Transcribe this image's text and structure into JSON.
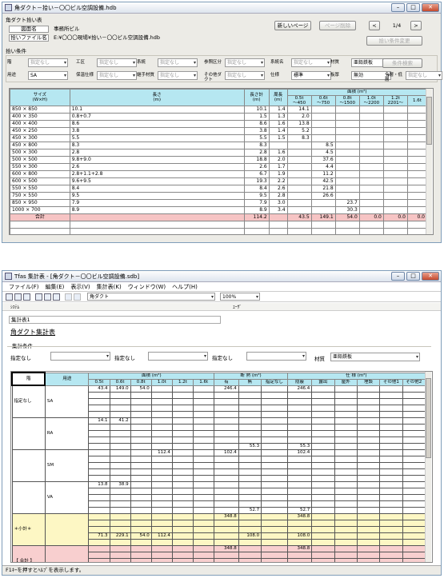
{
  "w1": {
    "title": "角ダクト－拾い－〇〇ビル空調設備.hdb",
    "section": "角ダクト拾い表",
    "drawing_label": "図面名",
    "drawing_value": "事務所ビル",
    "file_label": "拾いファイル名",
    "file_value": "E:¥〇〇〇現場¥拾い－〇〇ビル空調設備.hdb",
    "btn_new_page": "新しいページ",
    "btn_delete_page": "ページ削除",
    "btn_prev": "<",
    "page": "1/4",
    "btn_next": ">",
    "btn_change_cond": "拾い条件変更",
    "cond_label": "拾い条件",
    "btn_cond_search": "条件検索",
    "filters": [
      {
        "label": "階",
        "value": "指定なし"
      },
      {
        "label": "工区",
        "value": "指定なし"
      },
      {
        "label": "系統",
        "value": "指定なし"
      },
      {
        "label": "参照区分",
        "value": "指定なし"
      },
      {
        "label": "系統名",
        "value": "指定なし"
      },
      {
        "label": "材質",
        "value": "亜鉛鉄板",
        "on": true
      },
      {
        "label": "用途",
        "value": "SA",
        "on": true
      },
      {
        "label": "保温仕様",
        "value": "指定なし"
      },
      {
        "label": "継手材質",
        "value": "指定なし"
      },
      {
        "label": "その他ダクト",
        "value": "指定なし"
      },
      {
        "label": "仕様",
        "value": "標準",
        "on": true
      },
      {
        "label": "板厚",
        "value": "無効",
        "on": true
      },
      {
        "label": "全層・低層",
        "value": "指定なし"
      }
    ],
    "head": {
      "size": "サイズ\n(W×H)",
      "len": "長さ\n(m)",
      "total_len": "長さ計\n(m)",
      "peri": "周長\n(m)",
      "area": "面積 (m²)",
      "bands": [
        "0.5t\n～450",
        "0.6t\n～750",
        "0.8t\n～1500",
        "1.0t\n～2200",
        "1.2t\n2201～",
        "1.6t"
      ]
    },
    "rows": [
      [
        "850 × 850",
        "10.1",
        "10.1",
        "1.4",
        "14.1",
        "",
        "",
        "",
        "",
        ""
      ],
      [
        "400 × 350",
        "0.8+0.7",
        "1.5",
        "1.3",
        "2.0",
        "",
        "",
        "",
        "",
        ""
      ],
      [
        "400 × 400",
        "8.6",
        "8.6",
        "1.6",
        "13.8",
        "",
        "",
        "",
        "",
        ""
      ],
      [
        "450 × 250",
        "3.8",
        "3.8",
        "1.4",
        "5.2",
        "",
        "",
        "",
        "",
        ""
      ],
      [
        "450 × 300",
        "5.5",
        "5.5",
        "1.5",
        "8.3",
        "",
        "",
        "",
        "",
        ""
      ],
      [
        "450 × 800",
        "8.3",
        "8.3",
        "",
        "",
        "8.5",
        "",
        "",
        "",
        ""
      ],
      [
        "500 × 300",
        "2.8",
        "2.8",
        "1.6",
        "",
        "4.5",
        "",
        "",
        "",
        ""
      ],
      [
        "500 × 500",
        "9.8+9.0",
        "18.8",
        "2.0",
        "",
        "37.6",
        "",
        "",
        "",
        ""
      ],
      [
        "550 × 300",
        "2.6",
        "2.6",
        "1.7",
        "",
        "4.4",
        "",
        "",
        "",
        ""
      ],
      [
        "600 × 800",
        "2.8+1.1+2.8",
        "6.7",
        "1.9",
        "",
        "11.2",
        "",
        "",
        "",
        ""
      ],
      [
        "600 × 500",
        "9.6+9.5",
        "19.3",
        "2.2",
        "",
        "42.5",
        "",
        "",
        "",
        ""
      ],
      [
        "550 × 550",
        "8.4",
        "8.4",
        "2.6",
        "",
        "21.8",
        "",
        "",
        "",
        ""
      ],
      [
        "750 × 550",
        "9.5",
        "9.5",
        "2.8",
        "",
        "26.6",
        "",
        "",
        "",
        ""
      ],
      [
        "850 × 950",
        "7.9",
        "7.9",
        "3.0",
        "",
        "",
        "23.7",
        "",
        "",
        ""
      ],
      [
        "1000 × 700",
        "8.9",
        "8.9",
        "3.4",
        "",
        "",
        "30.3",
        "",
        "",
        ""
      ]
    ],
    "total": [
      "合計",
      "",
      "114.2",
      "",
      "43.5",
      "149.1",
      "54.0",
      "0.0",
      "0.0",
      "0.0"
    ]
  },
  "w2": {
    "title": "Tfas 集計表 - [角ダクト－〇〇ビル空調設備.sdb]",
    "menu": [
      "ファイル(F)",
      "編集(E)",
      "表示(V)",
      "集計表(K)",
      "ウィンドウ(W)",
      "ヘルプ(H)"
    ],
    "combo_type": "角ダクト",
    "zoom": "100%",
    "sys_label": "ｼｽﾃﾑ",
    "user_label": "ﾕｰｻﾞ",
    "sheet_name": "集計表1",
    "heading": "角ダクト集計表",
    "cond_label": "集計条件",
    "conds": [
      "指定なし",
      "指定なし",
      "指定なし"
    ],
    "material_label": "材質",
    "material_value": "亜鉛鉄板",
    "head": {
      "floor": "階",
      "use": "用途",
      "area": "面積 (m²)",
      "thick": [
        "0.5t",
        "0.6t",
        "0.8t",
        "1.0t",
        "1.2t",
        "1.6t"
      ],
      "insul": "断 熱 (m²)",
      "insul_cols": [
        "有",
        "無",
        "指定なし"
      ],
      "finish": "仕 様 (m²)",
      "finish_cols": [
        "隠蔽",
        "露出",
        "屋外",
        "埋設",
        "その他1",
        "その他2"
      ]
    },
    "groups": [
      {
        "floor": "指定なし",
        "use": "SA",
        "vals": [
          "43.4",
          "149.0",
          "54.0",
          "",
          "",
          "",
          "246.4",
          "",
          "",
          "246.4",
          "",
          "",
          "",
          "",
          ""
        ],
        "sub": [
          "",
          "",
          "",
          "",
          "",
          "",
          "",
          "",
          "",
          "",
          "",
          "",
          "",
          "",
          ""
        ]
      },
      {
        "floor": "",
        "use": "RA",
        "vals": [
          "14.1",
          "41.2",
          "",
          "",
          "",
          "",
          "",
          "",
          "",
          "",
          "",
          "",
          "",
          "",
          ""
        ],
        "sub": [
          "",
          "",
          "",
          "",
          "",
          "",
          "",
          "55.3",
          "",
          "55.3",
          "",
          "",
          "",
          "",
          ""
        ]
      },
      {
        "floor": "",
        "use": "SM",
        "vals": [
          "",
          "",
          "",
          "112.4",
          "",
          "",
          "102.4",
          "",
          "",
          "102.4",
          "",
          "",
          "",
          "",
          ""
        ],
        "sub": [
          "",
          "",
          "",
          "",
          "",
          "",
          "",
          "",
          "",
          "",
          "",
          "",
          "",
          "",
          ""
        ]
      },
      {
        "floor": "",
        "use": "VA",
        "vals": [
          "13.8",
          "38.9",
          "",
          "",
          "",
          "",
          "",
          "",
          "",
          "",
          "",
          "",
          "",
          "",
          ""
        ],
        "sub": [
          "",
          "",
          "",
          "",
          "",
          "",
          "",
          "52.7",
          "",
          "52.7",
          "",
          "",
          "",
          "",
          ""
        ]
      }
    ],
    "subtotal": {
      "label": "＊小計＊",
      "top": [
        "",
        "",
        "",
        "",
        "",
        "",
        "348.8",
        "",
        "",
        "348.8",
        "",
        "",
        "",
        "",
        ""
      ],
      "vals": [
        "71.3",
        "229.1",
        "54.0",
        "112.4",
        "",
        "",
        "",
        "108.0",
        "",
        "108.0",
        "",
        "",
        "",
        "",
        ""
      ]
    },
    "total": {
      "label": "【 合計 】",
      "top": [
        "",
        "",
        "",
        "",
        "",
        "",
        "348.8",
        "",
        "",
        "348.8",
        "",
        "",
        "",
        "",
        ""
      ],
      "vals": [
        "71.3",
        "229.1",
        "54.0",
        "112.4",
        "",
        "",
        "",
        "108.0",
        "",
        "108.0",
        "",
        "",
        "",
        "",
        ""
      ]
    },
    "status": "F1ｷｰを押すとﾍﾙﾌﾟを表示します。"
  },
  "colors": {
    "header_bg": "#b6e7f1",
    "total_bg": "#f6c4c4",
    "subtotal_bg": "#fdf7c4",
    "sum_bg": "#f8cfcf"
  }
}
